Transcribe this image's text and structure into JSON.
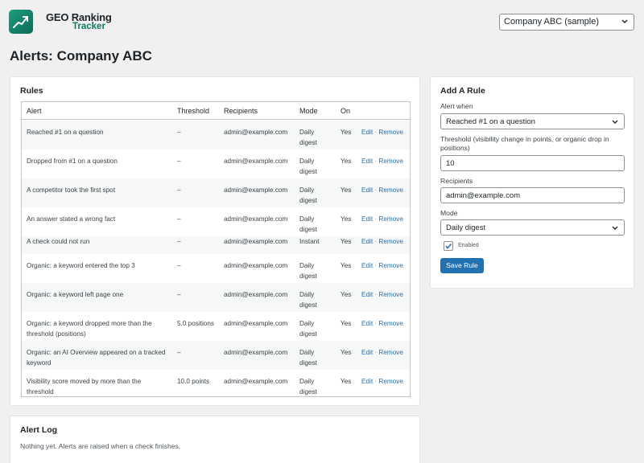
{
  "brand": {
    "line1": "GEO Ranking",
    "line2": "Tracker",
    "accent": "#0e7a5f"
  },
  "company_select": {
    "value": "Company ABC (sample)"
  },
  "page": {
    "title": "Alerts: Company ABC"
  },
  "rules": {
    "title": "Rules",
    "columns": [
      "Alert",
      "Threshold",
      "Recipients",
      "Mode",
      "On"
    ],
    "edit_label": "Edit",
    "separator": "·",
    "remove_label": "Remove",
    "rows": [
      {
        "alert": "Reached #1 on a question",
        "threshold": "–",
        "recipients": "admin@example.com",
        "mode": "Daily digest",
        "on": "Yes"
      },
      {
        "alert": "Dropped from #1 on a question",
        "threshold": "–",
        "recipients": "admin@example.com",
        "mode": "Daily digest",
        "on": "Yes"
      },
      {
        "alert": "A competitor took the first spot",
        "threshold": "–",
        "recipients": "admin@example.com",
        "mode": "Daily digest",
        "on": "Yes"
      },
      {
        "alert": "An answer stated a wrong fact",
        "threshold": "–",
        "recipients": "admin@example.com",
        "mode": "Daily digest",
        "on": "Yes"
      },
      {
        "alert": "A check could not run",
        "threshold": "–",
        "recipients": "admin@example.com",
        "mode": "Instant",
        "on": "Yes"
      },
      {
        "alert": "Organic: a keyword entered the top 3",
        "threshold": "–",
        "recipients": "admin@example.com",
        "mode": "Daily digest",
        "on": "Yes"
      },
      {
        "alert": "Organic: a keyword left page one",
        "threshold": "–",
        "recipients": "admin@example.com",
        "mode": "Daily digest",
        "on": "Yes"
      },
      {
        "alert": "Organic: a keyword dropped more than the threshold (positions)",
        "threshold": "5.0 positions",
        "recipients": "admin@example.com",
        "mode": "Daily digest",
        "on": "Yes"
      },
      {
        "alert": "Organic: an AI Overview appeared on a tracked keyword",
        "threshold": "–",
        "recipients": "admin@example.com",
        "mode": "Daily digest",
        "on": "Yes"
      },
      {
        "alert": "Visibility score moved by more than the threshold",
        "threshold": "10.0 points",
        "recipients": "admin@example.com",
        "mode": "Daily digest",
        "on": "Yes"
      }
    ]
  },
  "add_rule": {
    "title": "Add A Rule",
    "alert_when_label": "Alert when",
    "alert_when_value": "Reached #1 on a question",
    "threshold_label": "Threshold (visibility change in points, or organic drop in positions)",
    "threshold_value": "10",
    "recipients_label": "Recipients",
    "recipients_value": "admin@example.com",
    "mode_label": "Mode",
    "mode_value": "Daily digest",
    "enabled_label": "Enabled",
    "enabled_checked": true,
    "save_label": "Save Rule",
    "button_color": "#2271b1"
  },
  "alert_log": {
    "title": "Alert Log",
    "empty_text": "Nothing yet. Alerts are raised when a check finishes."
  }
}
